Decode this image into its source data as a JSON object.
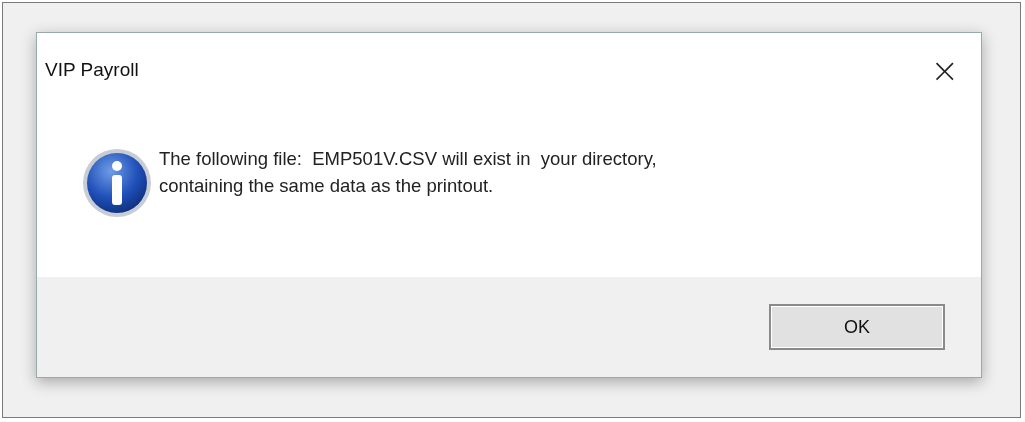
{
  "window": {
    "title": "VIP Payroll",
    "close": "×"
  },
  "message": {
    "kind": "info",
    "lines": [
      "The following file:  EMP501V.CSV will exist in  your directory,",
      "containing the same data as the printout."
    ]
  },
  "buttons": [
    "OK"
  ]
}
